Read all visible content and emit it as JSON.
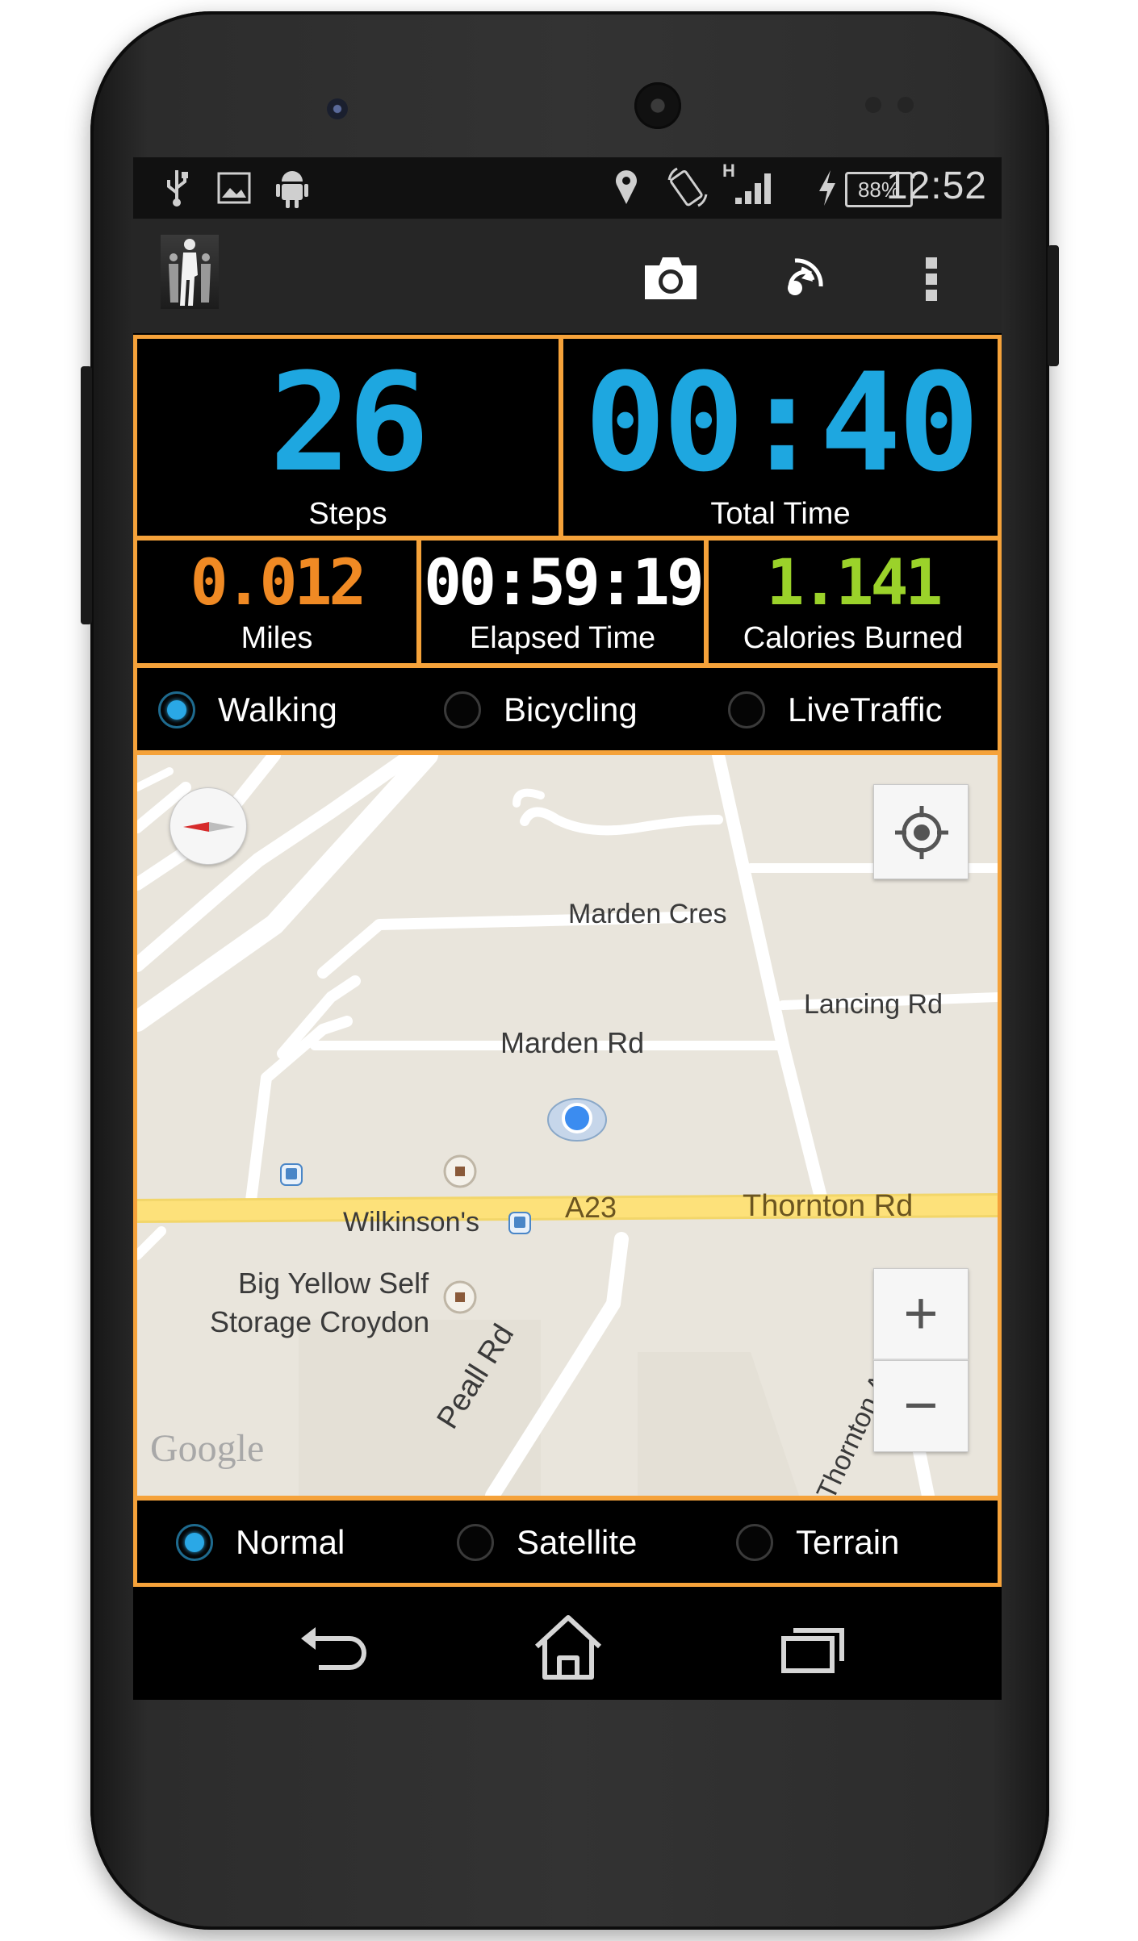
{
  "status_bar": {
    "time": "12:52",
    "battery": "88%",
    "network": "H",
    "icons": [
      "usb-icon",
      "image-icon",
      "android-icon",
      "location-icon",
      "rotation-icon",
      "signal-icon",
      "charging-icon",
      "battery-icon"
    ]
  },
  "action_bar": {
    "icons": [
      "app-logo",
      "camera-icon",
      "share-icon",
      "overflow-menu-icon"
    ]
  },
  "stats": {
    "steps": {
      "value": "26",
      "label": "Steps"
    },
    "total_time": {
      "value": "00:40",
      "label": "Total Time"
    },
    "miles": {
      "value": "0.012",
      "label": "Miles"
    },
    "elapsed_time": {
      "value": "00:59:19",
      "label": "Elapsed Time"
    },
    "calories": {
      "value": "1.141",
      "label": "Calories Burned"
    }
  },
  "activity_modes": {
    "selected": "Walking",
    "options": [
      "Walking",
      "Bicycling",
      "LiveTraffic"
    ]
  },
  "map": {
    "labels": {
      "marden_cres": "Marden Cres",
      "lancing_rd": "Lancing Rd",
      "marden_rd": "Marden Rd",
      "a23": "A23",
      "thornton_rd": "Thornton Rd",
      "wilkinsons": "Wilkinson's",
      "big_yellow_1": "Big Yellow Self",
      "big_yellow_2": "Storage Croydon",
      "peall_rd": "Peall Rd",
      "thornton_ave": "Thornton Ave",
      "watermark": "Google"
    },
    "zoom_in": "+",
    "zoom_out": "−",
    "colors": {
      "background": "#e9e5dc",
      "road": "#ffffff",
      "highway": "#fde17a",
      "location_dot": "#3b8cf0"
    }
  },
  "map_types": {
    "selected": "Normal",
    "options": [
      "Normal",
      "Satellite",
      "Terrain"
    ]
  },
  "nav_bar": {
    "icons": [
      "back-icon",
      "home-icon",
      "recent-apps-icon"
    ]
  },
  "colors": {
    "accent_border": "#f5a23a",
    "blue_digits": "#1ea7e0",
    "orange_digits": "#f08a24",
    "white_digits": "#ffffff",
    "green_digits": "#9bd22a"
  }
}
